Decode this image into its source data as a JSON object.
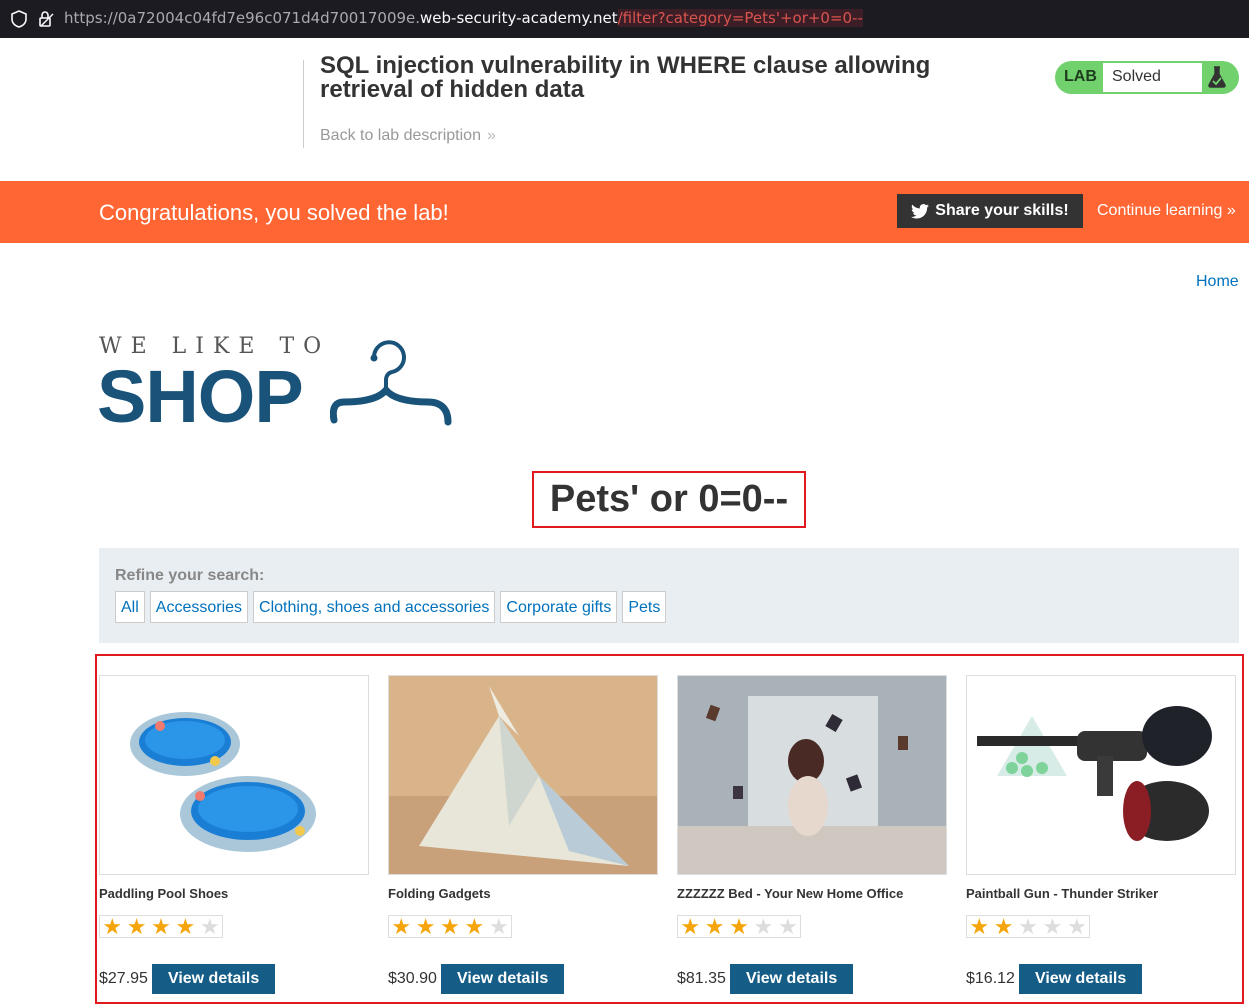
{
  "browser": {
    "url_prefix": "https://0a72004c04fd7e96c071d4d70017009e.",
    "url_host": "web-security-academy.net",
    "url_path": "/filter?category=Pets'+or+0=0--"
  },
  "lab": {
    "title": "SQL injection vulnerability in WHERE clause allowing retrieval of hidden data",
    "back_link": "Back to lab description",
    "status_tag": "LAB",
    "status_text": "Solved"
  },
  "banner": {
    "message": "Congratulations, you solved the lab!",
    "share_label": "Share your skills!",
    "continue_label": "Continue learning"
  },
  "nav": {
    "home": "Home"
  },
  "logo": {
    "small": "WE LIKE TO",
    "big": "SHOP"
  },
  "category_heading": "Pets' or 0=0--",
  "filter": {
    "label": "Refine your search:",
    "links": [
      "All",
      "Accessories",
      "Clothing, shoes and accessories",
      "Corporate gifts",
      "Pets"
    ]
  },
  "products": [
    {
      "name": "Paddling Pool Shoes",
      "rating": 4,
      "price": "$27.95",
      "button": "View details"
    },
    {
      "name": "Folding Gadgets",
      "rating": 4,
      "price": "$30.90",
      "button": "View details"
    },
    {
      "name": "ZZZZZZ Bed - Your New Home Office",
      "rating": 3,
      "price": "$81.35",
      "button": "View details"
    },
    {
      "name": "Paintball Gun - Thunder Striker",
      "rating": 2,
      "price": "$16.12",
      "button": "View details"
    }
  ],
  "colors": {
    "accent": "#ff6633",
    "brand": "#1a5379",
    "link": "#0071bc",
    "button": "#155c86",
    "solved": "#70d16d",
    "highlight": "#e0191e"
  }
}
